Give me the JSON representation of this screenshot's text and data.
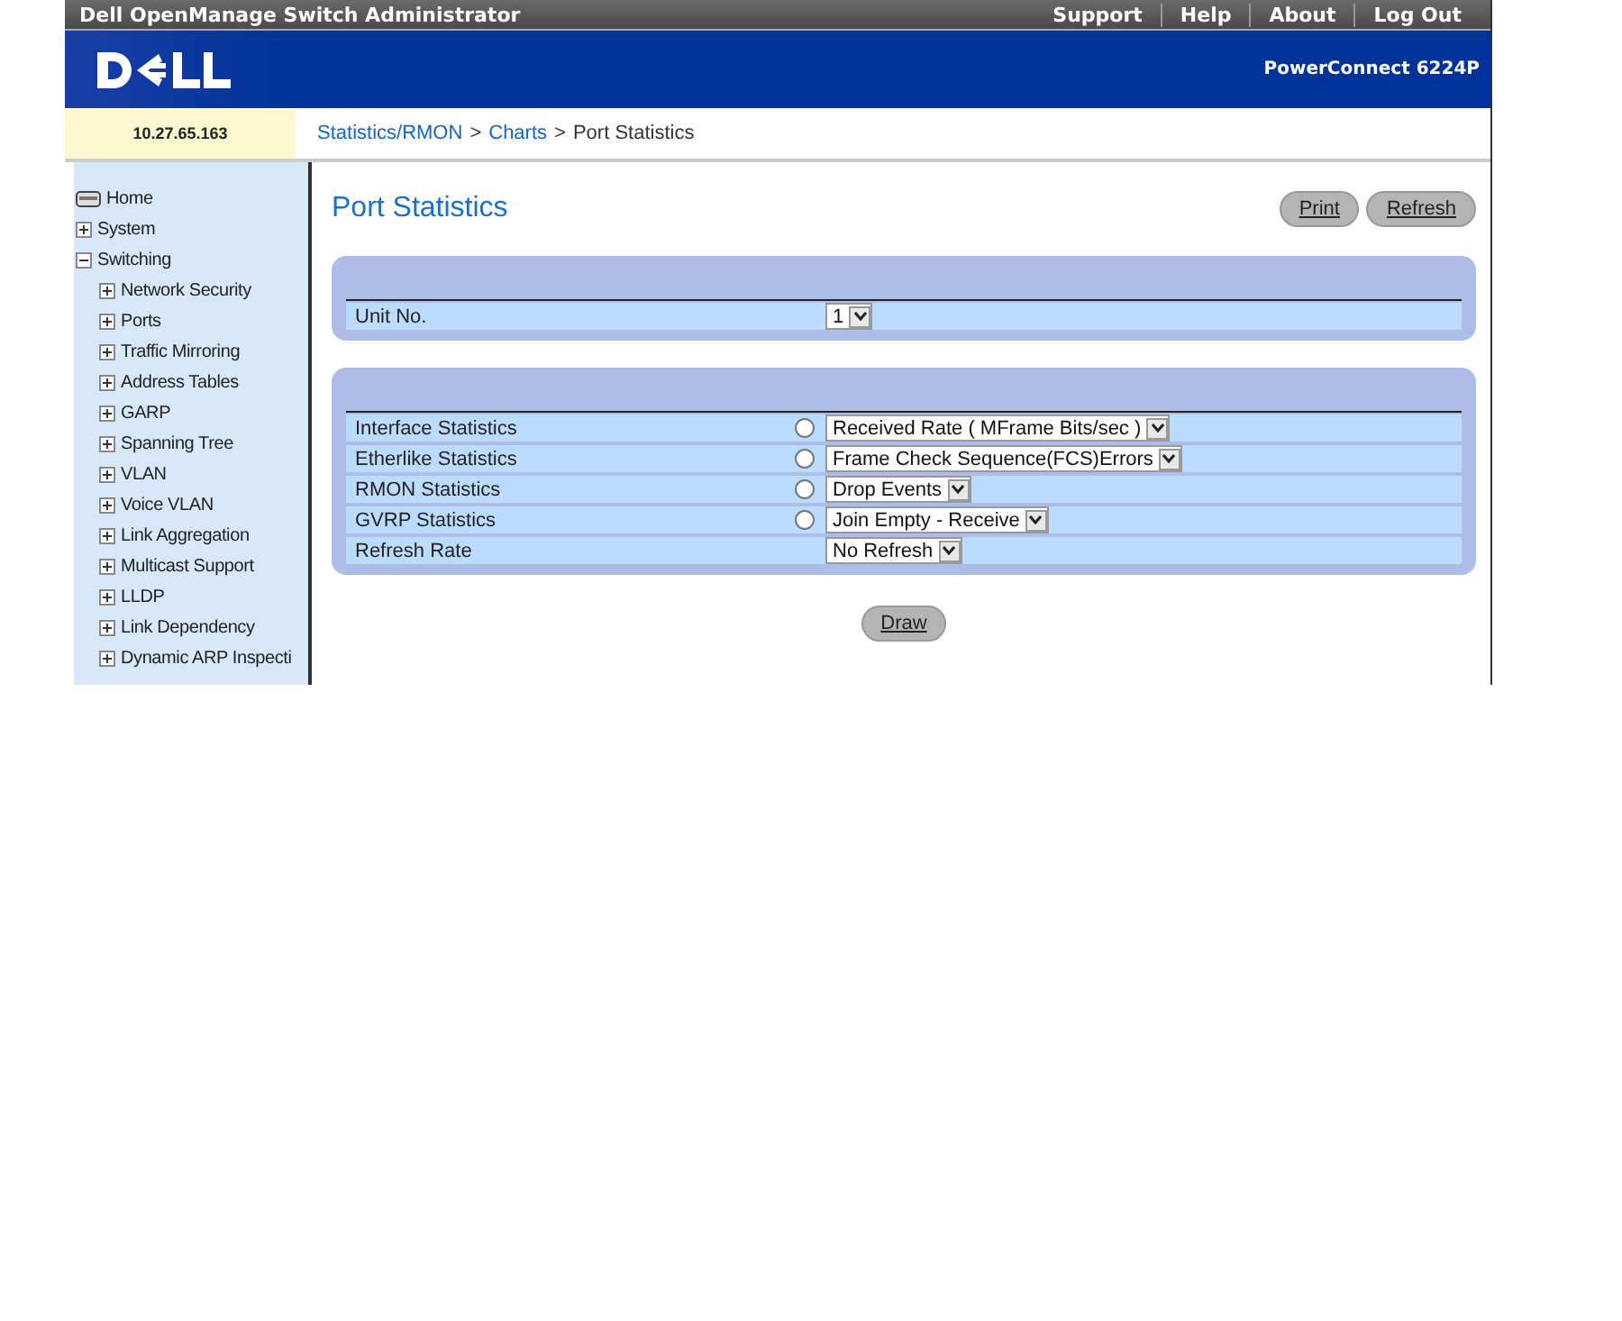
{
  "app_title": "Dell OpenManage Switch Administrator",
  "top_links": [
    "Support",
    "Help",
    "About",
    "Log Out"
  ],
  "model": "PowerConnect 6224P",
  "ip_address": "10.27.65.163",
  "breadcrumb": [
    {
      "label": "Statistics/RMON",
      "link": true
    },
    {
      "label": ">",
      "link": false
    },
    {
      "label": "Charts",
      "link": true
    },
    {
      "label": ">",
      "link": false
    },
    {
      "label": "Port Statistics",
      "link": false
    }
  ],
  "tree": [
    {
      "label": "Home",
      "kind": "home"
    },
    {
      "label": "System",
      "kind": "folder",
      "expanded": false
    },
    {
      "label": "Switching",
      "kind": "folder",
      "expanded": true,
      "children": [
        {
          "label": "Network Security",
          "kind": "folder",
          "expanded": false
        },
        {
          "label": "Ports",
          "kind": "folder",
          "expanded": false
        },
        {
          "label": "Traffic Mirroring",
          "kind": "folder",
          "expanded": false
        },
        {
          "label": "Address Tables",
          "kind": "folder",
          "expanded": false
        },
        {
          "label": "GARP",
          "kind": "folder",
          "expanded": false
        },
        {
          "label": "Spanning Tree",
          "kind": "folder",
          "expanded": false
        },
        {
          "label": "VLAN",
          "kind": "folder",
          "expanded": false
        },
        {
          "label": "Voice VLAN",
          "kind": "folder",
          "expanded": false
        },
        {
          "label": "Link Aggregation",
          "kind": "folder",
          "expanded": false
        },
        {
          "label": "Multicast Support",
          "kind": "folder",
          "expanded": false
        },
        {
          "label": "LLDP",
          "kind": "folder",
          "expanded": false
        },
        {
          "label": "Link Dependency",
          "kind": "folder",
          "expanded": false
        },
        {
          "label": "Dynamic ARP Inspecti",
          "kind": "folder",
          "expanded": false
        }
      ]
    }
  ],
  "page_title": "Port Statistics",
  "header_buttons": [
    "Print",
    "Refresh"
  ],
  "unit_panel": {
    "rows": [
      {
        "label": "Unit No.",
        "value": "1"
      }
    ]
  },
  "stats_panel": {
    "rows": [
      {
        "label": "Interface Statistics",
        "kind": "radio",
        "selected": false,
        "value": "Received Rate ( MFrame Bits/sec )"
      },
      {
        "label": "Etherlike Statistics",
        "kind": "radio",
        "selected": false,
        "value": "Frame Check Sequence(FCS)Errors"
      },
      {
        "label": "RMON Statistics",
        "kind": "radio",
        "selected": false,
        "value": "Drop Events"
      },
      {
        "label": "GVRP Statistics",
        "kind": "radio",
        "selected": false,
        "value": "Join Empty - Receive"
      },
      {
        "label": "Refresh Rate",
        "kind": "plain",
        "value": "No Refresh"
      }
    ]
  },
  "draw_button": "Draw"
}
